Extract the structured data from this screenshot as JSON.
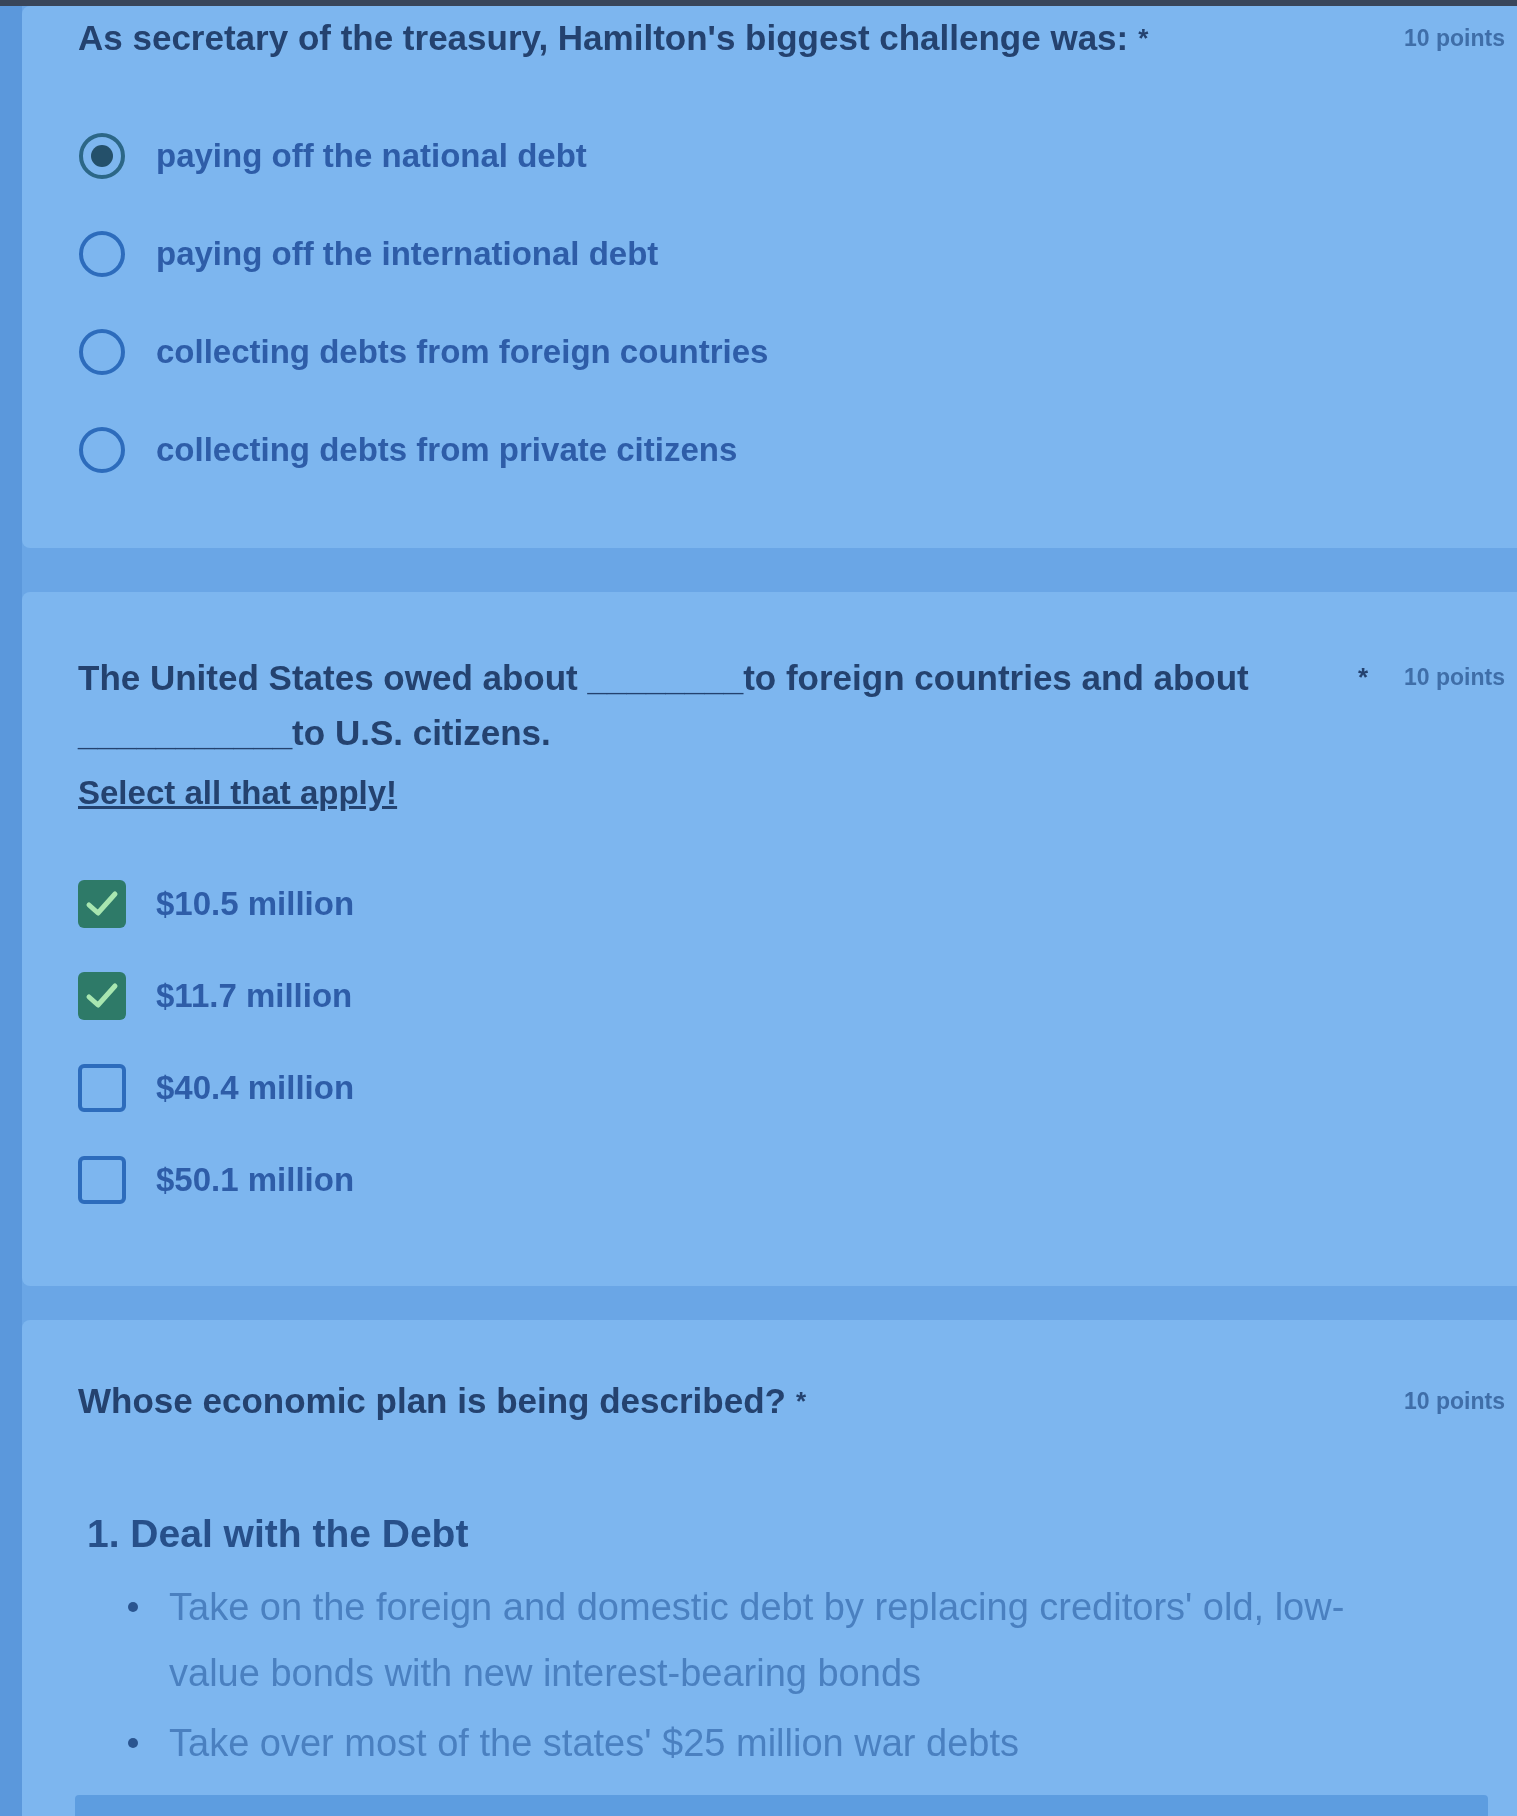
{
  "questions": [
    {
      "kind": "radio",
      "title": "As secretary of the treasury, Hamilton's biggest challenge was:",
      "required_mark": "*",
      "points": "10 points",
      "options": [
        {
          "label": "paying off the national debt",
          "selected": true
        },
        {
          "label": "paying off the international debt",
          "selected": false
        },
        {
          "label": "collecting debts from foreign countries",
          "selected": false
        },
        {
          "label": "collecting debts from private citizens",
          "selected": false
        }
      ]
    },
    {
      "kind": "checkbox",
      "title": "The United States owed about ________to foreign countries and about ___________to U.S. citizens.",
      "required_mark": "*",
      "points": "10 points",
      "note": "Select all that apply!",
      "options": [
        {
          "label": "$10.5 million",
          "checked": true
        },
        {
          "label": "$11.7 million",
          "checked": true
        },
        {
          "label": "$40.4 million",
          "checked": false
        },
        {
          "label": "$50.1 million",
          "checked": false
        }
      ]
    },
    {
      "kind": "description",
      "title": "Whose economic plan is being described?",
      "required_mark": "*",
      "points": "10 points",
      "description": {
        "heading": "1. Deal with the Debt",
        "bullets": [
          "Take on the foreign and domestic debt by replacing creditors' old, low-value bonds with new interest-bearing bonds",
          "Take over most of the states' $25 million war debts"
        ]
      }
    }
  ]
}
